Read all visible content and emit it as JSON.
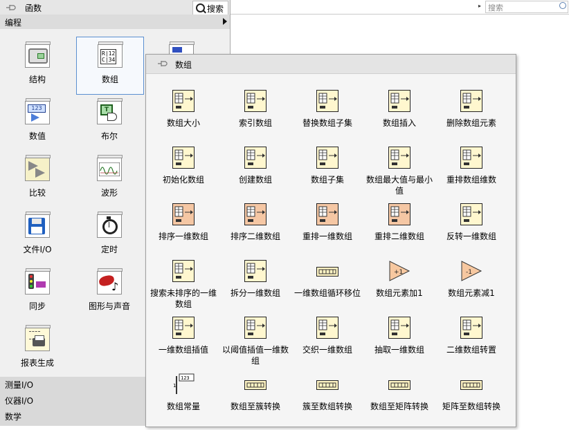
{
  "background": {
    "search_placeholder": "搜索"
  },
  "palette": {
    "title": "函数",
    "search_label": "搜索",
    "category": "编程",
    "items": [
      {
        "label": "结构",
        "icon": "structures-icon"
      },
      {
        "label": "数组",
        "icon": "array-icon"
      },
      {
        "label": "数值",
        "icon": "numeric-icon"
      },
      {
        "label": "布尔",
        "icon": "boolean-icon"
      },
      {
        "label": "比较",
        "icon": "comparison-icon"
      },
      {
        "label": "波形",
        "icon": "waveform-icon"
      },
      {
        "label": "文件I/O",
        "icon": "file-io-icon"
      },
      {
        "label": "定时",
        "icon": "timing-icon"
      },
      {
        "label": "同步",
        "icon": "synchronization-icon"
      },
      {
        "label": "图形与声音",
        "icon": "graphics-sound-icon"
      },
      {
        "label": "报表生成",
        "icon": "report-generation-icon"
      }
    ],
    "subcategories": [
      "测量I/O",
      "仪器I/O",
      "数学"
    ]
  },
  "subpalette": {
    "title": "数组",
    "items": [
      {
        "label": "数组大小",
        "icon": "array-size-icon"
      },
      {
        "label": "索引数组",
        "icon": "index-array-icon"
      },
      {
        "label": "替换数组子集",
        "icon": "replace-array-subset-icon"
      },
      {
        "label": "数组插入",
        "icon": "insert-into-array-icon"
      },
      {
        "label": "删除数组元素",
        "icon": "delete-from-array-icon"
      },
      {
        "label": "初始化数组",
        "icon": "initialize-array-icon"
      },
      {
        "label": "创建数组",
        "icon": "build-array-icon"
      },
      {
        "label": "数组子集",
        "icon": "array-subset-icon"
      },
      {
        "label": "数组最大值与最小值",
        "icon": "array-max-min-icon"
      },
      {
        "label": "重排数组维数",
        "icon": "reshape-array-icon"
      },
      {
        "label": "排序一维数组",
        "icon": "sort-1d-array-icon"
      },
      {
        "label": "排序二维数组",
        "icon": "sort-2d-array-icon"
      },
      {
        "label": "重排一维数组",
        "icon": "shuffle-1d-array-icon"
      },
      {
        "label": "重排二维数组",
        "icon": "shuffle-2d-array-icon"
      },
      {
        "label": "反转一维数组",
        "icon": "reverse-1d-array-icon"
      },
      {
        "label": "搜索未排序的一维数组",
        "icon": "search-unsorted-1d-array-icon"
      },
      {
        "label": "拆分一维数组",
        "icon": "split-1d-array-icon"
      },
      {
        "label": "一维数组循环移位",
        "icon": "rotate-1d-array-icon"
      },
      {
        "label": "数组元素加1",
        "icon": "increment-array-element-icon"
      },
      {
        "label": "数组元素减1",
        "icon": "decrement-array-element-icon"
      },
      {
        "label": "一维数组插值",
        "icon": "interpolate-1d-array-icon"
      },
      {
        "label": "以阈值插值一维数组",
        "icon": "threshold-1d-array-icon"
      },
      {
        "label": "交织一维数组",
        "icon": "interleave-1d-arrays-icon"
      },
      {
        "label": "抽取一维数组",
        "icon": "decimate-1d-array-icon"
      },
      {
        "label": "二维数组转置",
        "icon": "transpose-2d-array-icon"
      },
      {
        "label": "数组常量",
        "icon": "array-constant-icon"
      },
      {
        "label": "数组至簇转换",
        "icon": "array-to-cluster-icon"
      },
      {
        "label": "簇至数组转换",
        "icon": "cluster-to-array-icon"
      },
      {
        "label": "数组至矩阵转换",
        "icon": "array-to-matrix-icon"
      },
      {
        "label": "矩阵至数组转换",
        "icon": "matrix-to-array-icon"
      }
    ]
  }
}
